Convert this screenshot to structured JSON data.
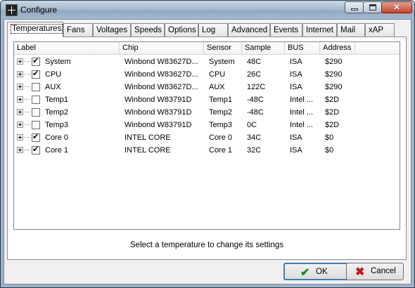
{
  "window": {
    "title": "Configure"
  },
  "tabs": [
    {
      "label": "Temperatures"
    },
    {
      "label": "Fans"
    },
    {
      "label": "Voltages"
    },
    {
      "label": "Speeds"
    },
    {
      "label": "Options"
    },
    {
      "label": "Log"
    },
    {
      "label": "Advanced"
    },
    {
      "label": "Events"
    },
    {
      "label": "Internet"
    },
    {
      "label": "Mail"
    },
    {
      "label": "xAP"
    }
  ],
  "active_tab": "Temperatures",
  "list": {
    "columns": [
      "Label",
      "Chip",
      "Sensor",
      "Sample",
      "BUS",
      "Address"
    ],
    "rows": [
      {
        "checked": true,
        "label": "System",
        "chip": "Winbond W83627D...",
        "sensor": "System",
        "sample": "48C",
        "bus": "ISA",
        "address": "$290"
      },
      {
        "checked": true,
        "label": "CPU",
        "chip": "Winbond W83627D...",
        "sensor": "CPU",
        "sample": "26C",
        "bus": "ISA",
        "address": "$290"
      },
      {
        "checked": false,
        "label": "AUX",
        "chip": "Winbond W83627D...",
        "sensor": "AUX",
        "sample": "122C",
        "bus": "ISA",
        "address": "$290"
      },
      {
        "checked": false,
        "label": "Temp1",
        "chip": "Winbond W83791D",
        "sensor": "Temp1",
        "sample": "-48C",
        "bus": "Intel ...",
        "address": "$2D"
      },
      {
        "checked": false,
        "label": "Temp2",
        "chip": "Winbond W83791D",
        "sensor": "Temp2",
        "sample": "-48C",
        "bus": "Intel ...",
        "address": "$2D"
      },
      {
        "checked": false,
        "label": "Temp3",
        "chip": "Winbond W83791D",
        "sensor": "Temp3",
        "sample": "0C",
        "bus": "Intel ...",
        "address": "$2D"
      },
      {
        "checked": true,
        "label": "Core 0",
        "chip": "INTEL CORE",
        "sensor": "Core 0",
        "sample": "34C",
        "bus": "ISA",
        "address": "$0"
      },
      {
        "checked": true,
        "label": "Core 1",
        "chip": "INTEL CORE",
        "sensor": "Core 1",
        "sample": "32C",
        "bus": "ISA",
        "address": "$0"
      }
    ]
  },
  "status_text": "Select a temperature to change its settings",
  "buttons": {
    "ok": {
      "label": "OK",
      "icon": "check-icon",
      "color": "#1a8a1a"
    },
    "cancel": {
      "label": "Cancel",
      "icon": "x-icon",
      "color": "#c01818"
    }
  }
}
